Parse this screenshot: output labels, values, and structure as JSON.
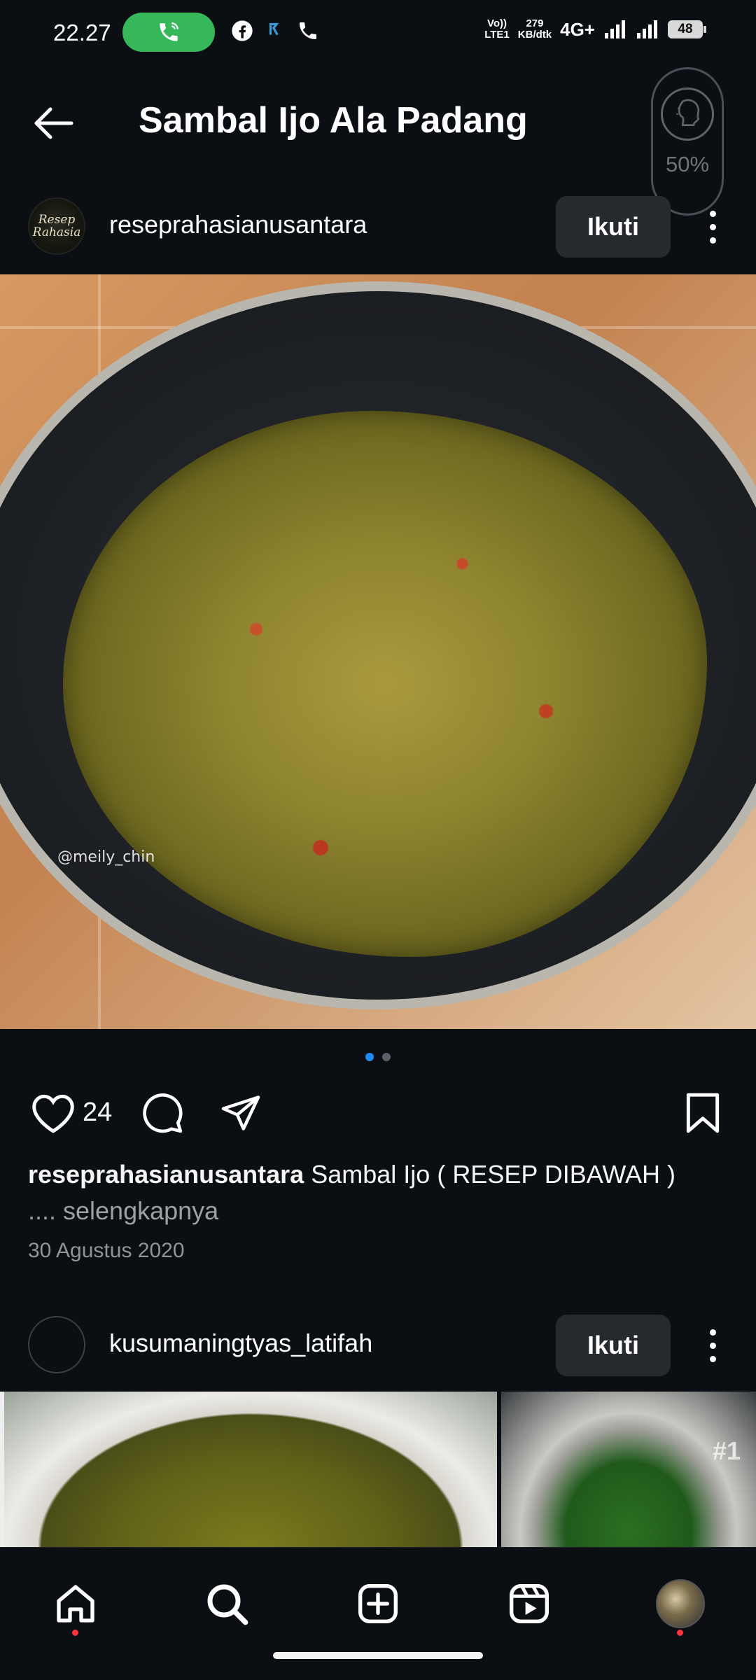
{
  "status_bar": {
    "time": "22.27",
    "net_type_top": "Vo))",
    "net_type_bottom": "LTE1",
    "speed_value": "279",
    "speed_unit": "KB/dtk",
    "network": "4G+",
    "battery": "48",
    "call_pill_color": "#36b85a"
  },
  "header": {
    "title": "Sambal Ijo Ala Padang",
    "zoom_level": "50%"
  },
  "post1": {
    "username": "reseprahasianusantara",
    "avatar_text": "Resep Rahasia",
    "follow_label": "Ikuti",
    "watermark": "@meily_chin",
    "carousel_pages": 2,
    "carousel_active_index": 0,
    "likes": "24",
    "caption_user": "reseprahasianusantara",
    "caption_text": "Sambal Ijo ( RESEP DIBAWAH )",
    "caption_more": ".... selengkapnya",
    "date": "30 Agustus 2020"
  },
  "post2": {
    "username": "kusumaningtyas_latifah",
    "follow_label": "Ikuti",
    "thumb_tag": "#1"
  },
  "bottom_nav": {
    "items": [
      "home-icon",
      "search-icon",
      "create-icon",
      "reels-icon",
      "profile-avatar"
    ],
    "active_dot_color": "#ff3040"
  },
  "colors": {
    "background": "#0b0f14",
    "accent_blue": "#1d8bf1",
    "button_bg": "#262a2f"
  }
}
